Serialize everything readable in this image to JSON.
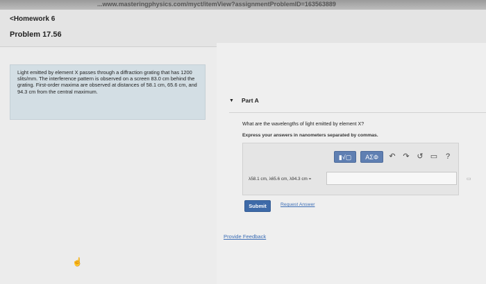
{
  "browser": {
    "url": "...www.masteringphysics.com/myct/itemView?assignmentProblemID=163563889"
  },
  "header": {
    "back_link": "<Homework 6",
    "problem_title": "Problem 17.56"
  },
  "problem": {
    "text": "Light emitted by element X passes through a diffraction grating that has 1200 slits/mm. The interference pattern is observed on a screen 83.0 cm behind the grating. First-order maxima are observed at distances of 58.1 cm, 65.6 cm, and 94.3 cm from the central maximum."
  },
  "part": {
    "toggle_icon": "▼",
    "title": "Part A",
    "question": "What are the wavelengths of light emitted by element X?",
    "instruction": "Express your answers in nanometers separated by commas.",
    "toolbar": {
      "template_btn": "▮√▢",
      "greek_btn": "ΑΣΦ",
      "undo": "↶",
      "redo": "↷",
      "reset": "↺",
      "keyboard": "▭",
      "help": "?"
    },
    "answer_label": "λ58.1 cm, λ65.6 cm, λ94.3 cm =",
    "answer_value": "",
    "submit_label": "Submit",
    "request_answer": "Request Answer"
  },
  "footer": {
    "feedback": "Provide Feedback"
  }
}
